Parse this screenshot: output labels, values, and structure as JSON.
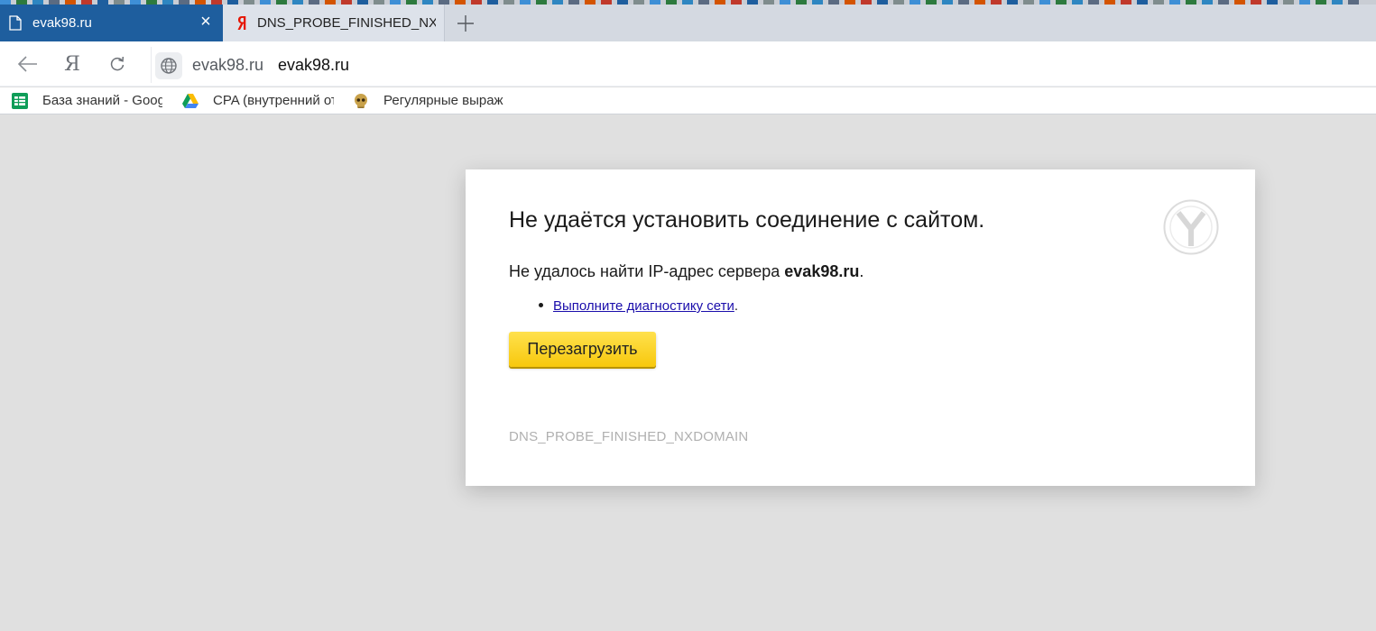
{
  "tabs": [
    {
      "title": "evak98.ru",
      "active": true,
      "icon": "document-icon"
    },
    {
      "title": "DNS_PROBE_FINISHED_NXDOMAIN",
      "active": false,
      "icon": "yandex-icon"
    }
  ],
  "tab_close_glyph": "×",
  "navbar": {
    "yandex_glyph": "Я",
    "address_domain": "evak98.ru",
    "address_url": "evak98.ru"
  },
  "bookmarks": [
    {
      "label": "База знаний - Google",
      "icon": "sheets-icon"
    },
    {
      "label": "CPA (внутренний отдел)",
      "icon": "drive-icon"
    },
    {
      "label": "Регулярные выражения",
      "icon": "skull-icon"
    }
  ],
  "error_page": {
    "title": "Не удаётся установить соединение с сайтом.",
    "message_prefix": "Не удалось найти IP-адрес сервера ",
    "message_host": "evak98.ru",
    "message_suffix": ".",
    "suggestion_link": "Выполните диагностику сети",
    "suggestion_suffix": ".",
    "reload_button": "Перезагрузить",
    "error_code": "DNS_PROBE_FINISHED_NXDOMAIN"
  },
  "colors": {
    "active_tab": "#1e5e9e",
    "page_background": "#e0e0e0",
    "reload_button": "#fcd82a",
    "link": "#1a0dab"
  }
}
